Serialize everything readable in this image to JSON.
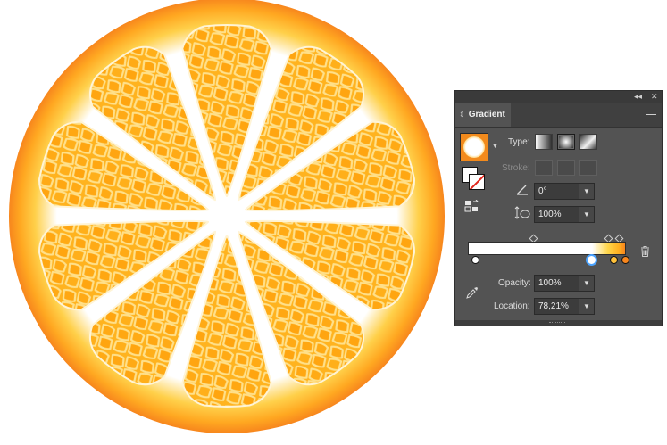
{
  "panel": {
    "tab_label": "Gradient",
    "collapse_icon": "collapse-icon",
    "close_icon": "close-icon",
    "menu_icon": "panel-menu-icon",
    "type_label": "Type:",
    "stroke_label": "Stroke:",
    "angle_value": "0°",
    "aspect_value": "100%",
    "opacity_label": "Opacity:",
    "opacity_value": "100%",
    "location_label": "Location:",
    "location_value": "78,21%",
    "gradient_type_selected": "radial"
  },
  "gradient": {
    "stops": [
      {
        "position": 0,
        "color": "#ffffff"
      },
      {
        "position": 0.7821,
        "color": "#ffffff"
      },
      {
        "position": 0.92,
        "color": "#ffc13a"
      },
      {
        "position": 1.0,
        "color": "#f7861d"
      }
    ],
    "midpoints": [
      0.42,
      0.9,
      0.97
    ]
  },
  "colors": {
    "rind_outer": "#f7861d",
    "rind_inner": "#ffb020",
    "pith": "#ffffff",
    "segment": "#ffb31f",
    "segment_cells": "#ffe08a"
  }
}
